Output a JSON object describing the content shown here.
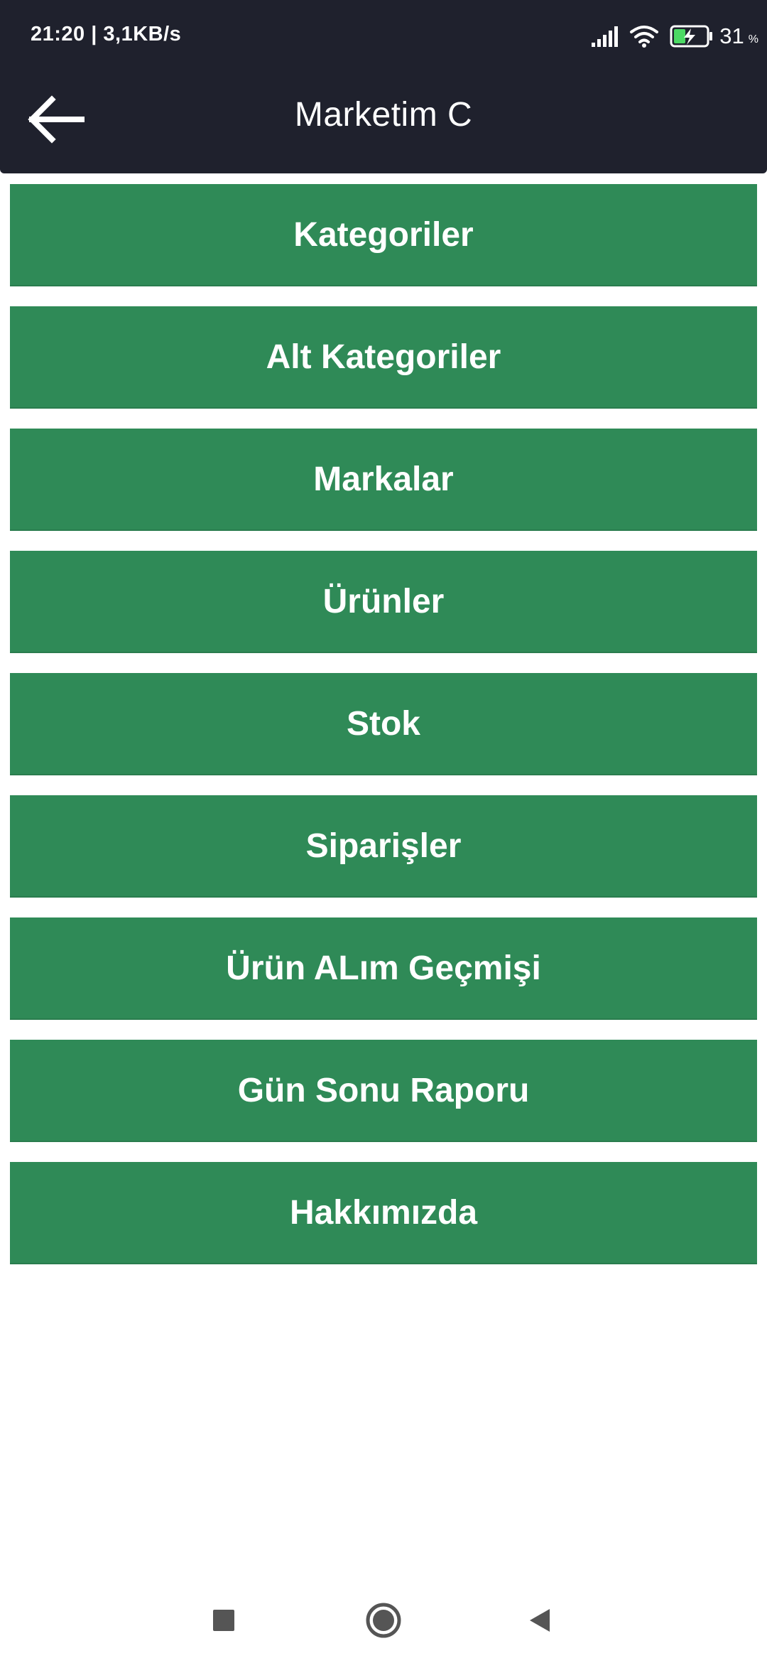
{
  "status_bar": {
    "time_speed": "21:20 | 3,1KB/s",
    "battery_percent": "31",
    "battery_unit": "%",
    "icons": [
      "signal-icon",
      "wifi-icon",
      "battery-charging-icon"
    ]
  },
  "app_bar": {
    "title": "Marketim C",
    "back_icon": "arrow-left-icon"
  },
  "menu": {
    "items": [
      {
        "label": "Kategoriler"
      },
      {
        "label": "Alt Kategoriler"
      },
      {
        "label": "Markalar"
      },
      {
        "label": "Ürünler"
      },
      {
        "label": "Stok"
      },
      {
        "label": "Siparişler"
      },
      {
        "label": "Ürün ALım Geçmişi"
      },
      {
        "label": "Gün Sonu Raporu"
      },
      {
        "label": "Hakkımızda"
      }
    ]
  },
  "navigation_bar": {
    "icons": [
      "recent-apps-icon",
      "home-icon",
      "back-icon"
    ]
  },
  "colors": {
    "header_background": "#1f212d",
    "button_green": "#2f8a57",
    "text_white": "#ffffff",
    "battery_accent": "#4cd964"
  }
}
